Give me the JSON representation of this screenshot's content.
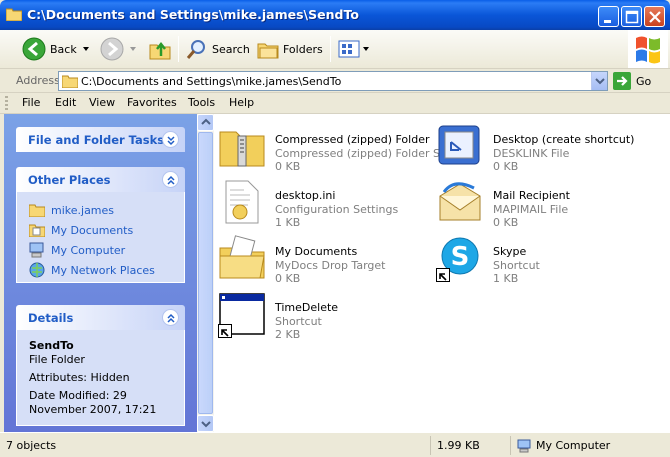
{
  "window": {
    "title": "C:\\Documents and Settings\\mike.james\\SendTo"
  },
  "toolbar": {
    "back_label": "Back",
    "search_label": "Search",
    "folders_label": "Folders"
  },
  "address": {
    "label": "Address",
    "path": "C:\\Documents and Settings\\mike.james\\SendTo",
    "go_label": "Go"
  },
  "menu": [
    "File",
    "Edit",
    "View",
    "Favorites",
    "Tools",
    "Help"
  ],
  "taskpane": {
    "tasks_title": "File and Folder Tasks",
    "places_title": "Other Places",
    "places": [
      "mike.james",
      "My Documents",
      "My Computer",
      "My Network Places"
    ],
    "details_title": "Details",
    "details": {
      "name": "SendTo",
      "kind": "File Folder",
      "attributes": "Attributes: Hidden",
      "modified": "Date Modified: 29 November 2007, 17:21"
    }
  },
  "files": [
    {
      "name": "Compressed (zipped) Folder",
      "type": "Compressed (zipped) Folder S...",
      "size": "0 KB",
      "icon": "zip-folder-icon"
    },
    {
      "name": "Desktop (create shortcut)",
      "type": "DESKLINK File",
      "size": "0 KB",
      "icon": "desktop-shortcut-icon"
    },
    {
      "name": "desktop.ini",
      "type": "Configuration Settings",
      "size": "1 KB",
      "icon": "config-file-icon"
    },
    {
      "name": "Mail Recipient",
      "type": "MAPIMAIL File",
      "size": "0 KB",
      "icon": "mail-envelope-icon"
    },
    {
      "name": "My Documents",
      "type": "MyDocs Drop Target",
      "size": "0 KB",
      "icon": "my-documents-folder-icon"
    },
    {
      "name": "Skype",
      "type": "Shortcut",
      "size": "1 KB",
      "icon": "skype-icon"
    },
    {
      "name": "TimeDelete",
      "type": "Shortcut",
      "size": "2 KB",
      "icon": "application-window-icon"
    }
  ],
  "status": {
    "objects": "7 objects",
    "size": "1.99 KB",
    "zone": "My Computer"
  },
  "colors": {
    "titlebar": "#0a56d8",
    "taskpane": "#6f8fdf",
    "link": "#215dc6"
  }
}
